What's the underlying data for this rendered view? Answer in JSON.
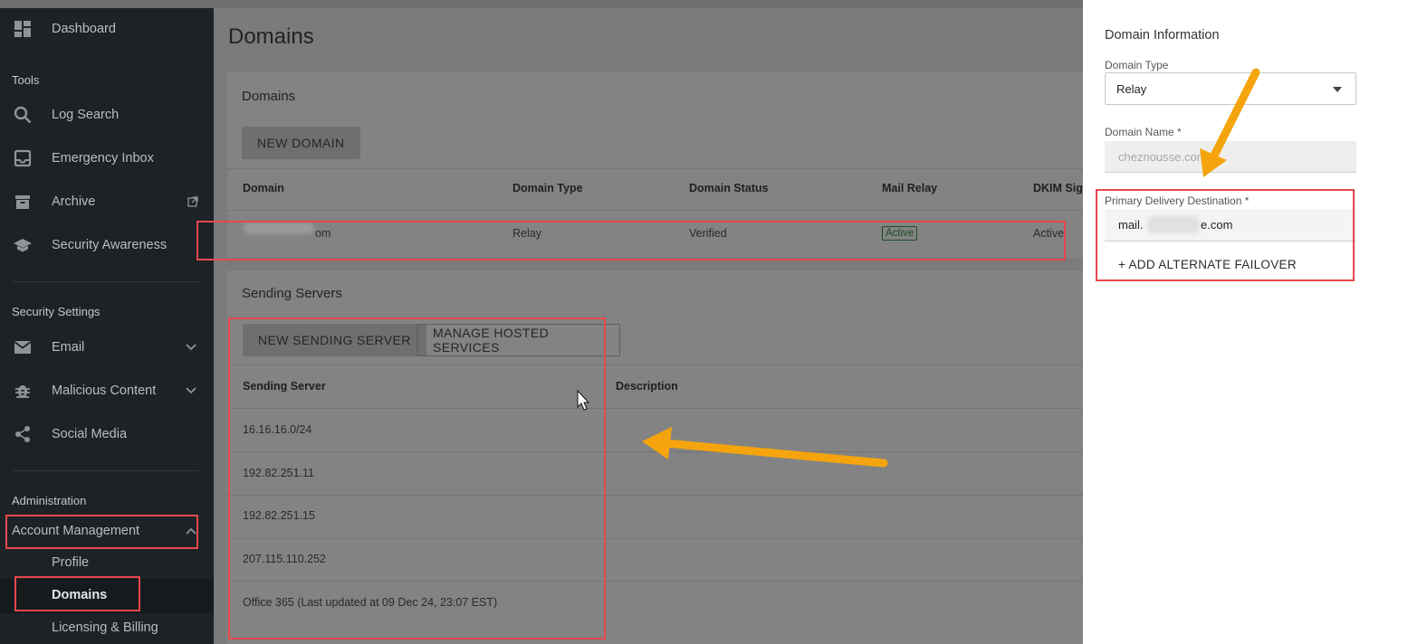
{
  "sidebar": {
    "dashboard": "Dashboard",
    "tools_header": "Tools",
    "log_search": "Log Search",
    "emergency_inbox": "Emergency Inbox",
    "archive": "Archive",
    "security_awareness": "Security Awareness",
    "security_settings_header": "Security Settings",
    "email": "Email",
    "malicious_content": "Malicious Content",
    "social_media": "Social Media",
    "administration_header": "Administration",
    "account_management": "Account Management",
    "profile": "Profile",
    "domains": "Domains",
    "licensing_billing": "Licensing & Billing"
  },
  "main": {
    "page_title": "Domains",
    "domains_card": {
      "title": "Domains",
      "new_domain_button": "NEW DOMAIN",
      "columns": [
        "Domain",
        "Domain Type",
        "Domain Status",
        "Mail Relay",
        "DKIM Sig"
      ],
      "row": {
        "domain_suffix": "om",
        "type": "Relay",
        "status": "Verified",
        "mail_relay": "Active",
        "dkim": "Active"
      }
    },
    "sending_card": {
      "title": "Sending Servers",
      "new_sending_server_button": "NEW SENDING SERVER",
      "manage_hosted_button": "MANAGE HOSTED SERVICES",
      "columns": [
        "Sending Server",
        "Description"
      ],
      "rows": [
        "16.16.16.0/24",
        "192.82.251.11",
        "192.82.251.15",
        "207.115.110.252",
        "Office 365 (Last updated at 09 Dec 24, 23:07 EST)"
      ]
    }
  },
  "panel": {
    "title": "Domain Information",
    "domain_type_label": "Domain Type",
    "domain_type_value": "Relay",
    "domain_name_label": "Domain Name *",
    "domain_name_value": "cheznousse.com",
    "primary_label": "Primary Delivery Destination *",
    "primary_value_prefix": "mail.",
    "primary_value_suffix": "e.com",
    "add_failover": "+ ADD ALTERNATE FAILOVER"
  },
  "colors": {
    "annotation_red": "#e8474d",
    "annotation_arrow": "#f5a40d",
    "sidebar_bg": "#1c2226",
    "badge_green": "#1d4d24"
  }
}
